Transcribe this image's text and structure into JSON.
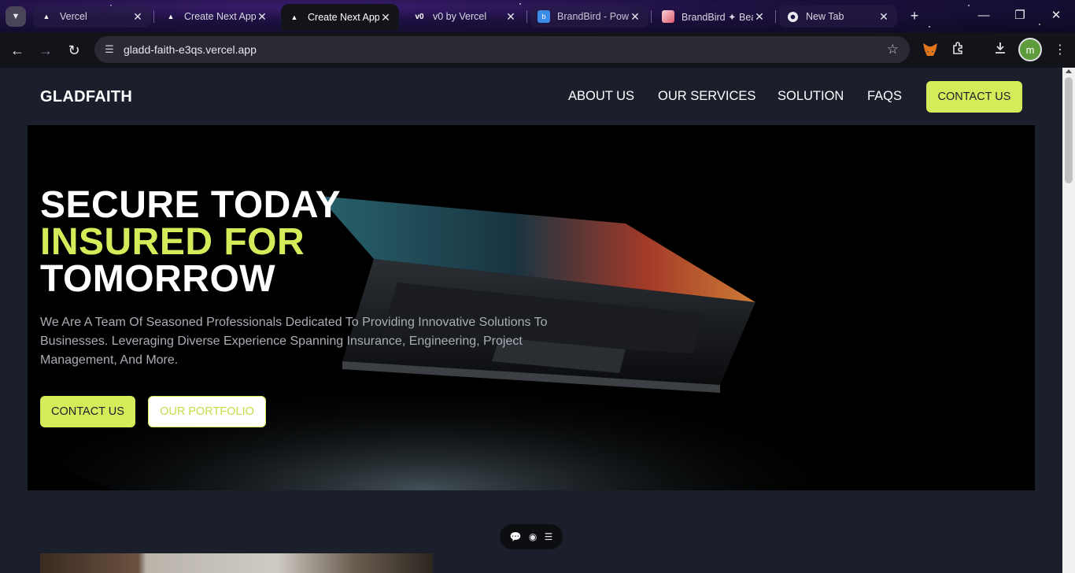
{
  "browser": {
    "tabs": [
      {
        "title": "Vercel",
        "favicon": "vercel-icon",
        "active": false
      },
      {
        "title": "Create Next App",
        "favicon": "vercel-icon",
        "active": false
      },
      {
        "title": "Create Next App",
        "favicon": "vercel-icon",
        "active": true
      },
      {
        "title": "v0 by Vercel",
        "favicon": "v0-icon",
        "active": false
      },
      {
        "title": "BrandBird - Pow",
        "favicon": "brandbird-icon",
        "active": false
      },
      {
        "title": "BrandBird ✦ Bea",
        "favicon": "brandbird-alt-icon",
        "active": false
      },
      {
        "title": "New Tab",
        "favicon": "chrome-icon",
        "active": false
      }
    ],
    "url": "gladd-faith-e3qs.vercel.app",
    "profile_initial": "m",
    "accent_colors": {
      "profile": "#5e9b3d"
    }
  },
  "site": {
    "brand": "GLADFAITH",
    "nav": [
      "ABOUT US",
      "OUR SERVICES",
      "SOLUTION",
      "FAQS"
    ],
    "header_cta": "CONTACT US",
    "hero": {
      "line1": "SECURE TODAY",
      "line2": "INSURED FOR",
      "line3": "TOMORROW",
      "description": "We Are A Team Of Seasoned Professionals Dedicated To Providing Innovative Solutions To Businesses. Leveraging Diverse Experience Spanning Insurance, Engineering, Project Management, And More.",
      "primary_cta": "CONTACT US",
      "secondary_cta": "OUR PORTFOLIO"
    },
    "colors": {
      "accent": "#d4ec59",
      "background": "#1b1e2b"
    }
  }
}
